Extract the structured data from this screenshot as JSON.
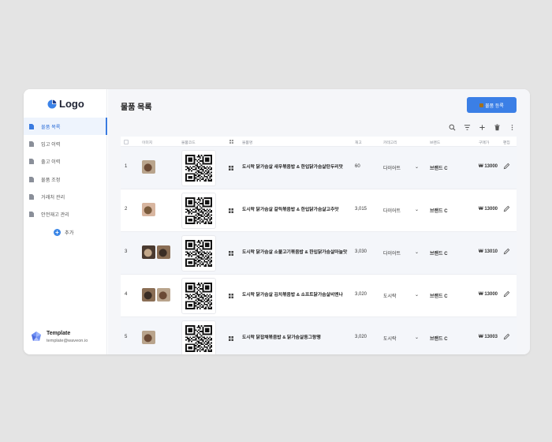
{
  "app": {
    "logo_text": "Logo"
  },
  "sidebar": {
    "items": [
      {
        "label": "물품 목록",
        "active": true
      },
      {
        "label": "입고 이력",
        "active": false
      },
      {
        "label": "출고 이력",
        "active": false
      },
      {
        "label": "물품 조정",
        "active": false
      },
      {
        "label": "거래처 관리",
        "active": false
      },
      {
        "label": "안전재고 관리",
        "active": false
      }
    ],
    "add_label": "추가",
    "user": {
      "name": "Template",
      "email": "template@waveon.io"
    }
  },
  "header": {
    "title": "물품 목록",
    "primary_button": "물품 등록"
  },
  "toolbar": {
    "icons": [
      "search-icon",
      "filter-icon",
      "plus-icon",
      "trash-icon",
      "more-icon"
    ]
  },
  "table": {
    "columns": {
      "image": "이미지",
      "code": "물품코드",
      "name": "물품명",
      "stock": "재고",
      "category": "카테고리",
      "brand": "브랜드",
      "price": "구매가",
      "edit": "편집"
    },
    "rows": [
      {
        "no": "1",
        "name": "도시락 닭가슴살 새우볶음밥 & 한입닭가슴살탄두리맛",
        "stock": "60",
        "category": "다이어트",
        "brand": "브랜드 C",
        "price": "₩ 13000",
        "thumbs": 1
      },
      {
        "no": "2",
        "name": "도시락 닭가슴살 갈릭볶음밥 & 한입닭가슴살고추맛",
        "stock": "3,015",
        "category": "다이어트",
        "brand": "브랜드 C",
        "price": "₩ 13000",
        "thumbs": 1
      },
      {
        "no": "3",
        "name": "도시락 닭가슴살 소불고기볶음밥 & 한입닭가슴살마늘맛",
        "stock": "3,030",
        "category": "다이어트",
        "brand": "브랜드 C",
        "price": "₩ 13010",
        "thumbs": 2
      },
      {
        "no": "4",
        "name": "도시락 닭가슴살 김치볶음밥 & 소프트닭가슴살비엔나",
        "stock": "3,020",
        "category": "도시락",
        "brand": "브랜드 C",
        "price": "₩ 13000",
        "thumbs": 2
      },
      {
        "no": "5",
        "name": "도시락 닭잡채볶음밥 & 닭가슴살동그랑땡",
        "stock": "3,020",
        "category": "도시락",
        "brand": "브랜드 C",
        "price": "₩ 13003",
        "thumbs": 1
      }
    ]
  },
  "help_label": "?",
  "colors": {
    "accent": "#3b7fe6",
    "active_bg": "#eef4fd",
    "row_alt": "#f4f6fa"
  }
}
